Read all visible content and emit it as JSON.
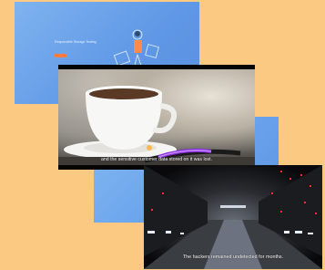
{
  "slide1": {
    "title": "Responsible Storage Testing",
    "footer": ""
  },
  "slide2": {
    "body": "",
    "footer": ""
  },
  "video": {
    "caption": "and the sensitive customer data stored on it was lost."
  },
  "server_video": {
    "caption": "The hackers remained undetected for months."
  },
  "colors": {
    "background": "#fcc983",
    "slide_blue": "#6aa3ec",
    "accent_orange": "#ff7a3c",
    "cable_purple": "#8a2be2"
  }
}
